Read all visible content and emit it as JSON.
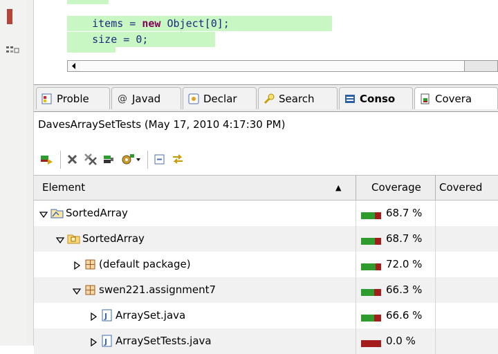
{
  "editor": {
    "line1_prefix": "items = ",
    "line1_kw": "new",
    "line1_suffix": " Object[0];",
    "line2": "size = 0;"
  },
  "tabs": [
    {
      "label": "Proble",
      "icon": "problems-icon"
    },
    {
      "label": "Javad",
      "icon": "javadoc-icon",
      "glyph": "@"
    },
    {
      "label": "Declar",
      "icon": "declaration-icon"
    },
    {
      "label": "Search",
      "icon": "search-icon"
    },
    {
      "label": "Conso",
      "icon": "console-icon"
    },
    {
      "label": "Covera",
      "icon": "coverage-icon"
    }
  ],
  "session": {
    "label": "DavesArraySetTests (May 17, 2010 4:17:30 PM)"
  },
  "toolbar": {
    "buttons": [
      "relaunch-icon",
      "remove-session-icon",
      "remove-all-sessions-icon",
      "merge-sessions-icon",
      "select-session-icon",
      "collapse-all-icon",
      "link-with-selection-icon"
    ]
  },
  "table": {
    "headers": {
      "element": "Element",
      "coverage": "Coverage",
      "covered": "Covered"
    },
    "sort_indicator": "▲",
    "rows": [
      {
        "name": "SortedArray",
        "coverage": "68.7 %",
        "level": 0,
        "twisty": "expanded",
        "icon": "java-project-icon",
        "fraction": 0.687
      },
      {
        "name": "SortedArray",
        "coverage": "68.7 %",
        "level": 1,
        "twisty": "expanded",
        "icon": "source-folder-icon",
        "fraction": 0.687
      },
      {
        "name": "(default package)",
        "coverage": "72.0 %",
        "level": 2,
        "twisty": "collapsed",
        "icon": "package-icon",
        "fraction": 0.72
      },
      {
        "name": "swen221.assignment7",
        "coverage": "66.3 %",
        "level": 2,
        "twisty": "expanded",
        "icon": "package-icon",
        "fraction": 0.663
      },
      {
        "name": "ArraySet.java",
        "coverage": "66.6 %",
        "level": 3,
        "twisty": "collapsed",
        "icon": "java-file-icon",
        "fraction": 0.666
      },
      {
        "name": "ArraySetTests.java",
        "coverage": "0.0 %",
        "level": 3,
        "twisty": "collapsed",
        "icon": "java-file-icon",
        "fraction": 0.0
      }
    ]
  },
  "colors": {
    "covered": "#2e9b2e",
    "missed": "#a31d1d",
    "code_highlight": "#c9f7c3",
    "keyword": "#7f0055"
  }
}
